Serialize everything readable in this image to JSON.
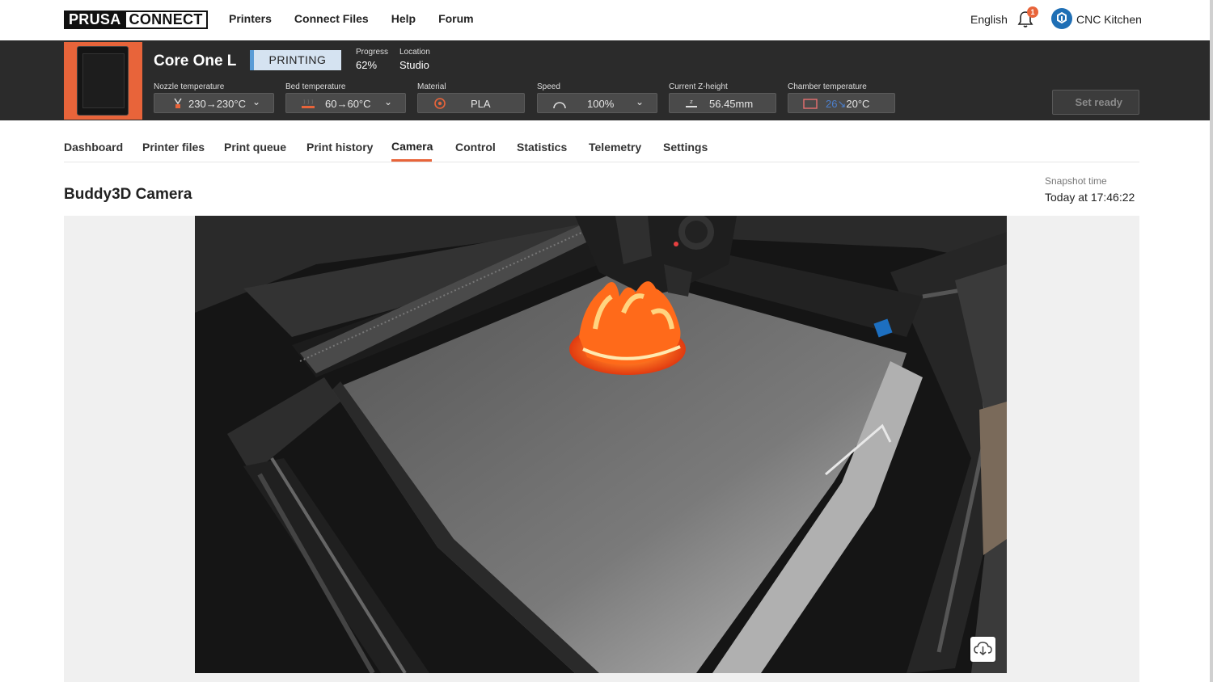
{
  "brand": {
    "logo_left": "PRUSA",
    "logo_right": "CONNECT"
  },
  "nav": {
    "links": [
      "Printers",
      "Connect Files",
      "Help",
      "Forum"
    ],
    "language": "English",
    "notification_count": "1",
    "user_name": "CNC Kitchen"
  },
  "printer": {
    "name": "Core One L",
    "state": "PRINTING",
    "progress_label": "Progress",
    "progress_value": "62%",
    "location_label": "Location",
    "location_value": "Studio",
    "controls": {
      "nozzle": {
        "label": "Nozzle temperature",
        "value": "230→230°C"
      },
      "bed": {
        "label": "Bed temperature",
        "value": "60→60°C"
      },
      "material": {
        "label": "Material",
        "value": "PLA"
      },
      "speed": {
        "label": "Speed",
        "value": "100%"
      },
      "zheight": {
        "label": "Current Z-height",
        "value": "56.45mm"
      },
      "chamber": {
        "label": "Chamber temperature",
        "target": "26",
        "value": "20°C"
      }
    },
    "set_ready_label": "Set ready"
  },
  "tabs": [
    "Dashboard",
    "Printer files",
    "Print queue",
    "Print history",
    "Camera",
    "Control",
    "Statistics",
    "Telemetry",
    "Settings"
  ],
  "active_tab": "Camera",
  "camera": {
    "title": "Buddy3D Camera",
    "snapshot_label": "Snapshot time",
    "snapshot_value": "Today at 17:46:22"
  },
  "colors": {
    "accent": "#e8643a",
    "header_bg": "#2b2b2b",
    "state_badge_bg": "#d5e3f1",
    "state_badge_border": "#5a9cd6"
  }
}
